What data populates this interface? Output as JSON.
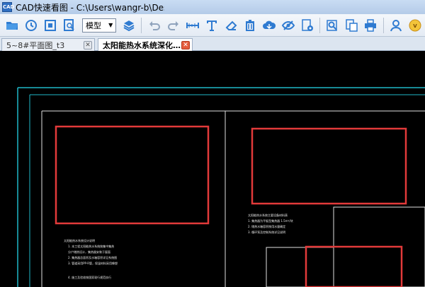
{
  "window": {
    "app_icon": "CAD",
    "title": "CAD快速看图 - C:\\Users\\wangr-b\\Deskto"
  },
  "toolbar": {
    "icons": [
      "open-folder-icon",
      "history-clock-icon",
      "zoom-extents-icon",
      "find-in-doc-icon",
      "layers-icon",
      "undo-icon",
      "redo-icon",
      "measure-icon",
      "text-icon",
      "eraser-icon",
      "trash-icon",
      "cloud-icon",
      "eye-hide-icon",
      "settings-icon",
      "search-doc-icon",
      "export-icon",
      "print-icon",
      "user-icon",
      "vip-icon"
    ],
    "mode_select": "模型"
  },
  "tabs": [
    {
      "label": "5~8#平面图_t3",
      "active": false
    },
    {
      "label": "太阳能热水系统深化…",
      "active": true
    }
  ],
  "drawing": {
    "notes_left": [
      "太阳能热水系统设计说明",
      "1. 本工程太阳能热水系统按集中集热",
      "   分户储热设计，集热器安装于屋面",
      "2. 集热器总面积及水箱容积详见系统图",
      "3. 管道采用PP-R管，保温材料采用橡塑",
      "4. 施工及验收按国家现行规范执行"
    ],
    "notes_right": [
      "太阳能热水系统主要设备材料表",
      "1. 集热器为平板型集热器 1.5m²/块",
      "2. 储热水箱容积按用水量确定",
      "3. 循环泵及控制系统详见说明"
    ]
  },
  "colors": {
    "highlight_box": "#e23a3a",
    "outer_frame": "#1fb8c8",
    "inner_frame": "#e0e0e0"
  }
}
